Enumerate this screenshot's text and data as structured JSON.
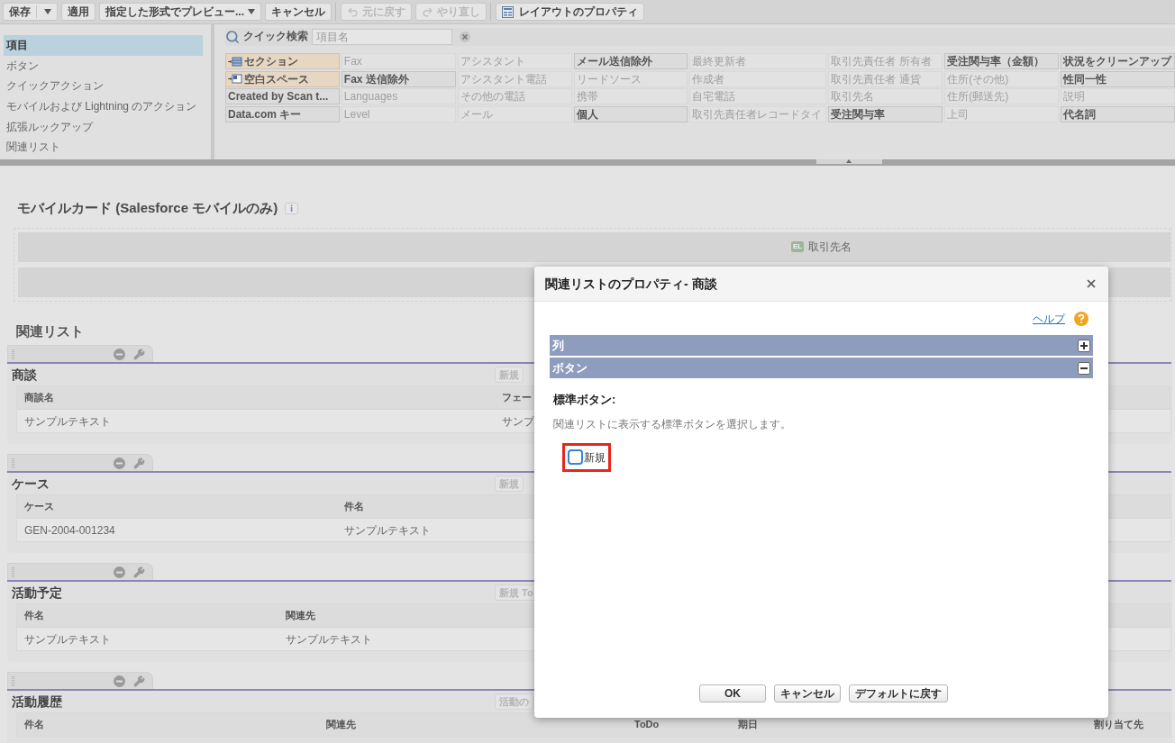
{
  "toolbar": {
    "groups": [
      [
        {
          "label": "保存",
          "kind": "split",
          "disabled": false
        },
        {
          "label": "適用",
          "kind": "plain",
          "disabled": false
        },
        {
          "label": "指定した形式でプレビュー...",
          "kind": "menu",
          "disabled": false
        },
        {
          "label": "キャンセル",
          "kind": "plain",
          "disabled": false
        }
      ],
      [
        {
          "label": "元に戻す",
          "kind": "undo",
          "disabled": true
        },
        {
          "label": "やり直し",
          "kind": "redo",
          "disabled": true
        }
      ],
      [
        {
          "label": "レイアウトのプロパティ",
          "kind": "properties",
          "disabled": false
        }
      ]
    ]
  },
  "palette": {
    "sidebar": [
      {
        "label": "項目",
        "selected": true
      },
      {
        "label": "ボタン",
        "selected": false
      },
      {
        "label": "クイックアクション",
        "selected": false
      },
      {
        "label": "モバイルおよび Lightning のアクション",
        "selected": false
      },
      {
        "label": "拡張ルックアップ",
        "selected": false
      },
      {
        "label": "関連リスト",
        "selected": false
      }
    ],
    "quick_search": {
      "label": "クイック検索",
      "placeholder": "項目名"
    },
    "fields": [
      {
        "label": "セクション",
        "kind": "section",
        "in_layout": false
      },
      {
        "label": "Fax",
        "kind": "field",
        "in_layout": true
      },
      {
        "label": "アシスタント",
        "kind": "field",
        "in_layout": true
      },
      {
        "label": "メール送信除外",
        "kind": "field",
        "in_layout": false
      },
      {
        "label": "最終更新者",
        "kind": "field",
        "in_layout": true
      },
      {
        "label": "取引先責任者 所有者",
        "kind": "field",
        "in_layout": true
      },
      {
        "label": "受注関与率（金額）",
        "kind": "field",
        "in_layout": false
      },
      {
        "label": "状況をクリーンアップ",
        "kind": "field",
        "in_layout": false
      },
      {
        "label": "空白スペース",
        "kind": "blank",
        "in_layout": false
      },
      {
        "label": "Fax 送信除外",
        "kind": "field",
        "in_layout": false
      },
      {
        "label": "アシスタント電話",
        "kind": "field",
        "in_layout": true
      },
      {
        "label": "リードソース",
        "kind": "field",
        "in_layout": true
      },
      {
        "label": "作成者",
        "kind": "field",
        "in_layout": true
      },
      {
        "label": "取引先責任者 通貨",
        "kind": "field",
        "in_layout": true
      },
      {
        "label": "住所(その他)",
        "kind": "field",
        "in_layout": true
      },
      {
        "label": "性同一性",
        "kind": "field",
        "in_layout": false
      },
      {
        "label": "Created by Scan t...",
        "kind": "field",
        "in_layout": false
      },
      {
        "label": "Languages",
        "kind": "field",
        "in_layout": true
      },
      {
        "label": "その他の電話",
        "kind": "field",
        "in_layout": true
      },
      {
        "label": "携帯",
        "kind": "field",
        "in_layout": true
      },
      {
        "label": "自宅電話",
        "kind": "field",
        "in_layout": true
      },
      {
        "label": "取引先名",
        "kind": "field",
        "in_layout": true
      },
      {
        "label": "住所(郵送先)",
        "kind": "field",
        "in_layout": true
      },
      {
        "label": "説明",
        "kind": "field",
        "in_layout": true
      },
      {
        "label": "Data.com キー",
        "kind": "field",
        "in_layout": false
      },
      {
        "label": "Level",
        "kind": "field",
        "in_layout": true
      },
      {
        "label": "メール",
        "kind": "field",
        "in_layout": true
      },
      {
        "label": "個人",
        "kind": "field",
        "in_layout": false
      },
      {
        "label": "取引先責任者レコードタイ",
        "kind": "field",
        "in_layout": true
      },
      {
        "label": "受注関与率",
        "kind": "field",
        "in_layout": false
      },
      {
        "label": "上司",
        "kind": "field",
        "in_layout": true
      },
      {
        "label": "代名詞",
        "kind": "field",
        "in_layout": false
      }
    ]
  },
  "mobile_card": {
    "title": "モバイルカード (Salesforce モバイルのみ)",
    "slots": [
      {
        "kind": "field",
        "icon_text": "EL",
        "label": "取引先名"
      },
      {
        "kind": "empty"
      }
    ]
  },
  "related_lists": {
    "title": "関連リスト",
    "lists": [
      {
        "title": "商談",
        "buttons": [
          "新規"
        ],
        "columns": [
          "商談名",
          "フェー"
        ],
        "rows": [
          [
            "サンプルテキスト",
            "サンプ"
          ]
        ]
      },
      {
        "title": "ケース",
        "buttons": [
          "新規"
        ],
        "columns": [
          "ケース",
          "件名"
        ],
        "rows": [
          [
            "GEN-2004-001234",
            "サンプルテキスト"
          ]
        ]
      },
      {
        "title": "活動予定",
        "buttons": [
          "新規 To"
        ],
        "columns": [
          "件名",
          "関連先"
        ],
        "rows": [
          [
            "サンプルテキスト",
            "サンプルテキスト"
          ]
        ]
      },
      {
        "title": "活動履歴",
        "buttons": [
          "活動の"
        ],
        "columns": [
          "件名",
          "関連先",
          "ToDo",
          "期日",
          "割り当て先"
        ]
      }
    ]
  },
  "dialog": {
    "title": "関連リストのプロパティ- 商談",
    "help": "ヘルプ",
    "sections": [
      {
        "title": "列",
        "expanded": false
      },
      {
        "title": "ボタン",
        "expanded": true
      }
    ],
    "standard_buttons": {
      "heading": "標準ボタン:",
      "description": "関連リストに表示する標準ボタンを選択します。",
      "options": [
        {
          "label": "新規",
          "checked": false,
          "kind": "highlighted"
        }
      ]
    },
    "buttons": [
      "OK",
      "キャンセル",
      "デフォルトに戻す"
    ]
  }
}
